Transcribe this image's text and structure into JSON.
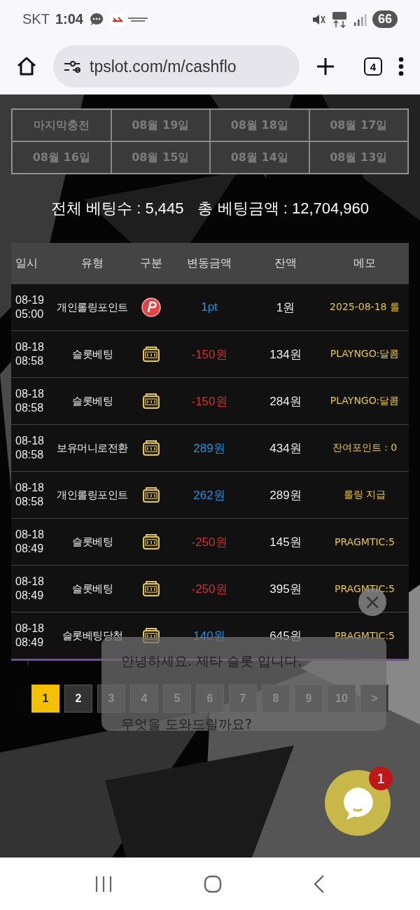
{
  "status_bar": {
    "carrier": "SKT",
    "time": "1:04",
    "battery": "66"
  },
  "browser": {
    "url": "tpslot.com/m/cashflo",
    "tab_count": "4"
  },
  "date_tabs": [
    {
      "label": "마지막충전",
      "selected": false
    },
    {
      "label": "08월 19일",
      "selected": false
    },
    {
      "label": "08월 18일",
      "selected": false
    },
    {
      "label": "08월 17일",
      "selected": false
    },
    {
      "label": "08월 16일",
      "selected": false
    },
    {
      "label": "08월 15일",
      "selected": false
    },
    {
      "label": "08월 14일",
      "selected": false
    },
    {
      "label": "08월 13일",
      "selected": false
    }
  ],
  "summary": {
    "count_label": "전체 베팅수 : 5,445",
    "amount_label": "총 베팅금액 : 12,704,960"
  },
  "table": {
    "columns": [
      "일시",
      "유형",
      "구분",
      "변동금액",
      "잔액",
      "메모"
    ],
    "rows": [
      {
        "date": "08-19",
        "time": "05:00",
        "type": "개인롤링포인트",
        "kind": "point",
        "amount": "1pt",
        "color": "#2a8de0",
        "balance": "1원",
        "memo": "2025-08-18 롤"
      },
      {
        "date": "08-18",
        "time": "08:58",
        "type": "슬롯베팅",
        "kind": "slot",
        "amount": "-150원",
        "color": "#d03030",
        "balance": "134원",
        "memo": "PLAYNGO:달콤"
      },
      {
        "date": "08-18",
        "time": "08:58",
        "type": "슬롯베팅",
        "kind": "slot",
        "amount": "-150원",
        "color": "#d03030",
        "balance": "284원",
        "memo": "PLAYNGO:달콤"
      },
      {
        "date": "08-18",
        "time": "08:58",
        "type": "보유머니로전환",
        "kind": "slot",
        "amount": "289원",
        "color": "#2a8de0",
        "balance": "434원",
        "memo": "잔여포인트 : 0"
      },
      {
        "date": "08-18",
        "time": "08:58",
        "type": "개인롤링포인트",
        "kind": "slot",
        "amount": "262원",
        "color": "#2a8de0",
        "balance": "289원",
        "memo": "롤링 지급"
      },
      {
        "date": "08-18",
        "time": "08:49",
        "type": "슬롯베팅",
        "kind": "slot",
        "amount": "-250원",
        "color": "#d03030",
        "balance": "145원",
        "memo": "PRAGMTIC:5"
      },
      {
        "date": "08-18",
        "time": "08:49",
        "type": "슬롯베팅",
        "kind": "slot",
        "amount": "-250원",
        "color": "#d03030",
        "balance": "395원",
        "memo": "PRAGMTIC:5"
      },
      {
        "date": "08-18",
        "time": "08:49",
        "type": "슬롯베팅당첨",
        "kind": "slot",
        "amount": "140원",
        "color": "#2a8de0",
        "balance": "645원",
        "memo": "PRAGMTIC:5"
      }
    ]
  },
  "pagination": [
    {
      "label": "1",
      "selected": true
    },
    {
      "label": "2",
      "selected": false
    },
    {
      "label": "3",
      "selected": false
    },
    {
      "label": "4",
      "selected": false
    },
    {
      "label": "5",
      "selected": false
    },
    {
      "label": "6",
      "selected": false
    },
    {
      "label": "7",
      "selected": false
    },
    {
      "label": "8",
      "selected": false
    },
    {
      "label": "9",
      "selected": false
    },
    {
      "label": "10",
      "selected": false
    },
    {
      "label": ">",
      "selected": false
    }
  ],
  "chat_popup": {
    "lines": [
      "안녕하세요. 제타 슬롯 입니다.",
      "무엇을 도와드릴까요?"
    ],
    "close": "×"
  },
  "chat_button": {
    "badge": "1"
  }
}
